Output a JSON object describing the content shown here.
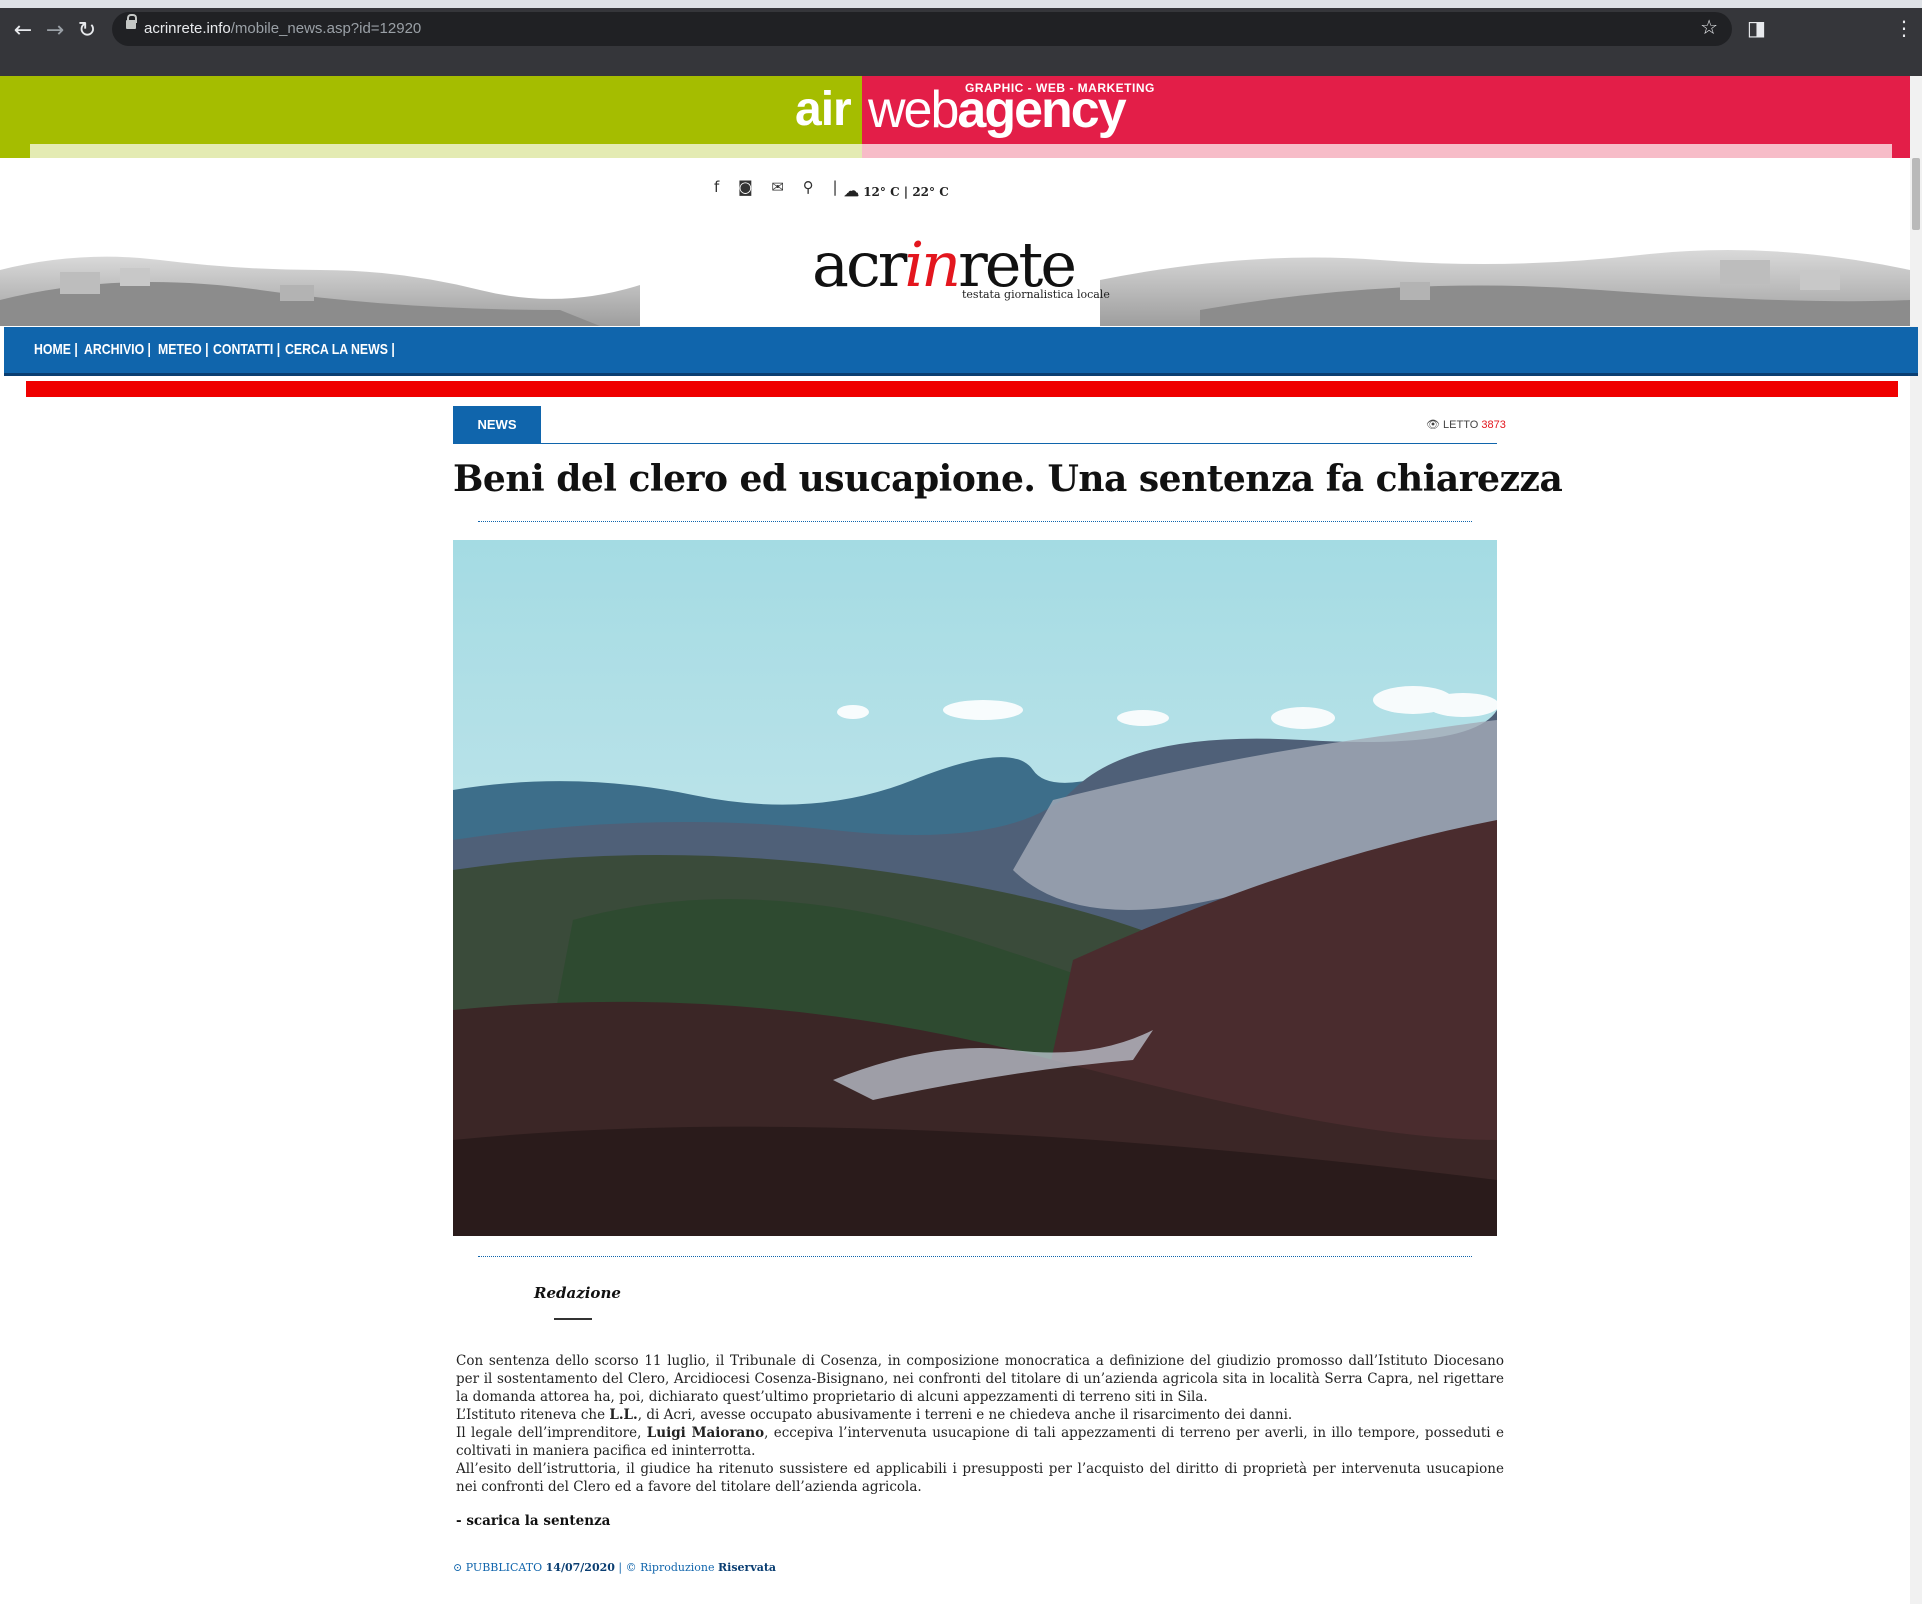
{
  "browser": {
    "back_label": "←",
    "forward_label": "→",
    "reload_label": "↻",
    "url_domain": "acrinrete.info",
    "url_path": "/mobile_news.asp?id=12920",
    "bookmark_label": "☆",
    "sidepanel_label": "◨",
    "menu_label": "⋮"
  },
  "ad_banner": {
    "word1": "air",
    "word2": "web",
    "word3": "agency",
    "tagline": "GRAPHIC -  WEB - MARKETING",
    "colors": {
      "left": "#a5bd00",
      "right": "#e31e48"
    }
  },
  "header": {
    "icons": [
      "facebook-icon",
      "instagram-icon",
      "envelope-icon",
      "search-icon"
    ],
    "separator": "|",
    "weather_text": "12° C | 22° C",
    "logo_part1": "acr",
    "logo_part2": "in",
    "logo_part3": "rete",
    "logo_subtitle": "testata giornalistica locale"
  },
  "nav": {
    "items": [
      "HOME |",
      "ARCHIVIO |",
      "METEO |",
      "CONTATTI |",
      "CERCA LA NEWS |"
    ],
    "colors": {
      "bar": "#1065ac",
      "accent": "#ef0000"
    }
  },
  "article": {
    "category": "NEWS",
    "views_label": "LETTO",
    "views_count": "3873",
    "title": "Beni del clero ed usucapione. Una sentenza fa chiarezza",
    "author": "Redazione",
    "paragraphs": [
      {
        "pre": "Con sentenza dello scorso 11 luglio, il Tribunale di Cosenza, in composizione monocratica a definizione del giudizio promosso dall’Istituto Diocesano per il sostentamento del Clero, Arcidiocesi Cosenza-Bisignano, nei confronti del titolare di un’azienda agricola sita in località Serra Capra, nel rigettare la domanda attorea ha, poi, dichiarato quest’ultimo proprietario di alcuni appezzamenti di terreno siti in Sila.",
        "bold": "",
        "post": ""
      },
      {
        "pre": "L’Istituto riteneva che ",
        "bold": "L.L.",
        "post": ", di Acri, avesse occupato abusivamente i terreni e ne chiedeva anche il risarcimento dei danni."
      },
      {
        "pre": "Il legale dell’imprenditore, ",
        "bold": "Luigi Maiorano",
        "post": ", eccepiva l’intervenuta usucapione di tali appezzamenti di terreno per averli, in illo tempore, posseduti e coltivati in maniera pacifica ed ininterrotta."
      },
      {
        "pre": "All’esito dell’istruttoria, il giudice ha ritenuto sussistere ed applicabili i presupposti per l’acquisto del diritto di proprietà per intervenuta usucapione nei confronti del Clero ed a favore del titolare dell’azienda agricola.",
        "bold": "",
        "post": ""
      }
    ],
    "download_prefix": "- ",
    "download_label": "scarica la sentenza",
    "published_label": "PUBBLICATO",
    "published_date": "14/07/2020",
    "footer_sep": "|",
    "copyright_label": "© Riproduzione",
    "copyright_bold": "Riservata"
  }
}
